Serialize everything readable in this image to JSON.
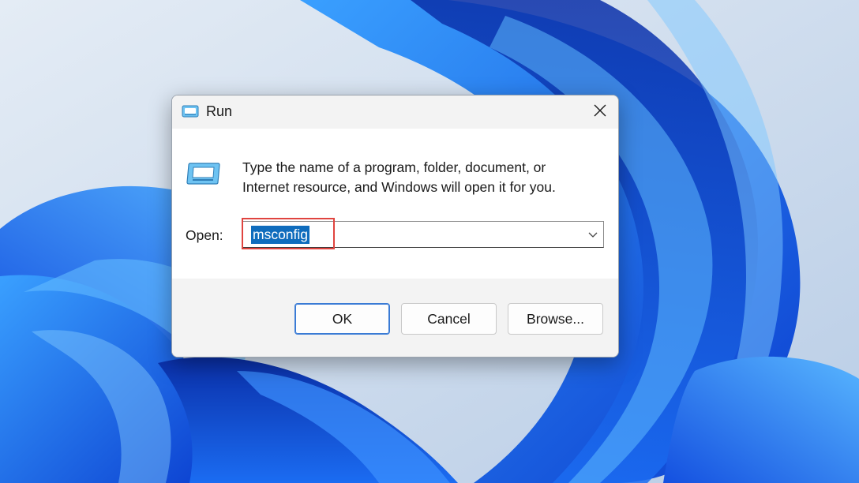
{
  "dialog": {
    "title": "Run",
    "description": "Type the name of a program, folder, document, or Internet resource, and Windows will open it for you.",
    "open_label": "Open:",
    "input_value": "msconfig",
    "buttons": {
      "ok": "OK",
      "cancel": "Cancel",
      "browse": "Browse..."
    }
  },
  "icons": {
    "title": "run-icon",
    "content": "run-icon",
    "close": "close-icon",
    "dropdown": "chevron-down-icon"
  },
  "colors": {
    "selection": "#0f6cbd",
    "annotation": "#e0443f",
    "ok_border": "#3a7bd5"
  }
}
